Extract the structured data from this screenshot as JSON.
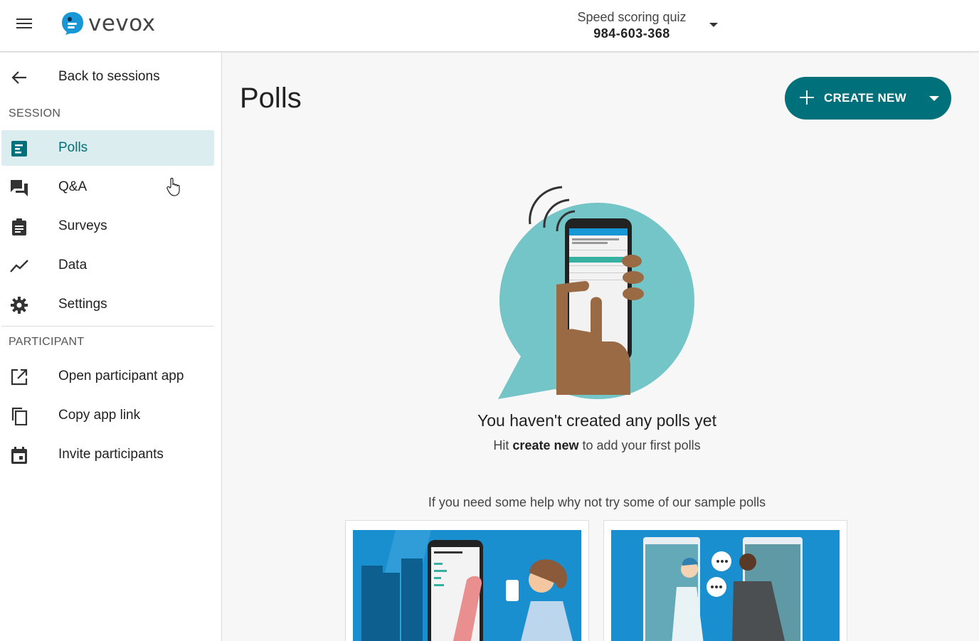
{
  "header": {
    "brand": "vevox",
    "session_title": "Speed scoring quiz",
    "session_code": "984-603-368"
  },
  "sidebar": {
    "back_label": "Back to sessions",
    "session_heading": "SESSION",
    "session_items": [
      {
        "label": "Polls",
        "icon": "polls-icon",
        "active": true
      },
      {
        "label": "Q&A",
        "icon": "qa-chat-icon",
        "active": false
      },
      {
        "label": "Surveys",
        "icon": "clipboard-icon",
        "active": false
      },
      {
        "label": "Data",
        "icon": "trend-line-icon",
        "active": false
      },
      {
        "label": "Settings",
        "icon": "gear-icon",
        "active": false
      }
    ],
    "participant_heading": "PARTICIPANT",
    "participant_items": [
      {
        "label": "Open participant app",
        "icon": "open-external-icon"
      },
      {
        "label": "Copy app link",
        "icon": "copy-icon"
      },
      {
        "label": "Invite participants",
        "icon": "calendar-icon"
      }
    ]
  },
  "main": {
    "title": "Polls",
    "create_label": "CREATE NEW",
    "empty_title": "You haven't created any polls yet",
    "empty_sub_prefix": "Hit",
    "empty_sub_bold": "create new",
    "empty_sub_suffix": "to add your first polls",
    "sample_hint": "If you need some help why not try some of our sample polls"
  },
  "colors": {
    "brand_teal": "#00707a",
    "active_bg": "#dcedef",
    "bubble": "#74c5c7",
    "sample_blue": "#1a8fd0"
  }
}
